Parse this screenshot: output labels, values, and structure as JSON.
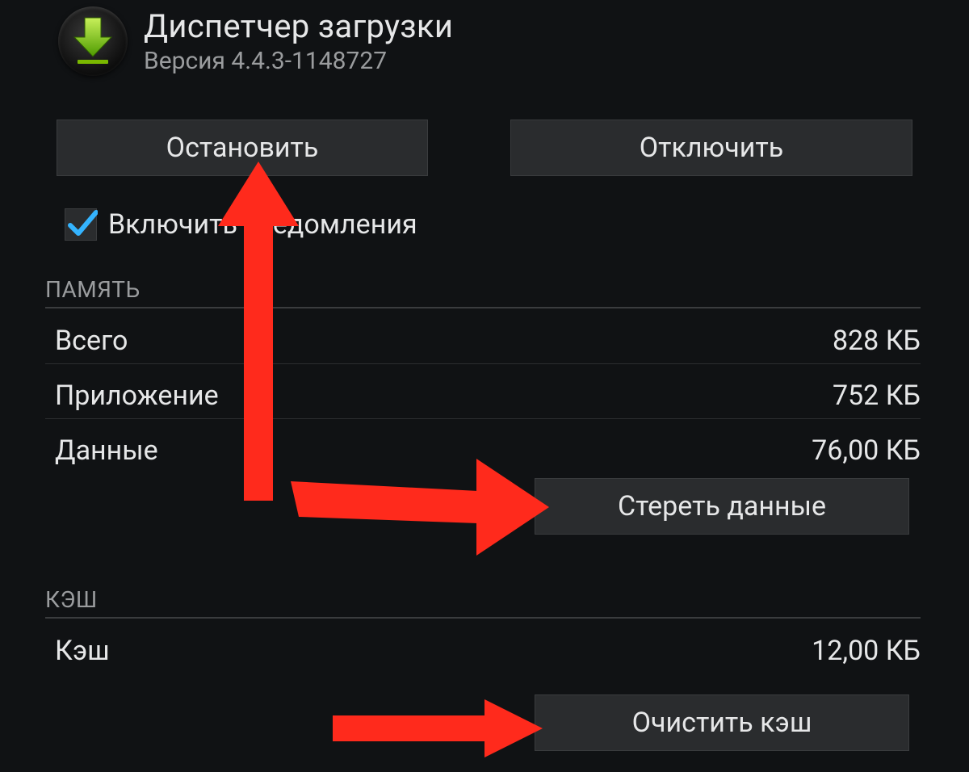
{
  "header": {
    "title": "Диспетчер загрузки",
    "version": "Версия 4.4.3-1148727"
  },
  "buttons": {
    "stop": "Остановить",
    "disable": "Отключить",
    "clear_data": "Стереть данные",
    "clear_cache": "Очистить кэш"
  },
  "checkbox": {
    "label": "Включить уведомления",
    "checked": true
  },
  "sections": {
    "memory_title": "ПАМЯТЬ",
    "cache_title": "КЭШ"
  },
  "memory": {
    "total_label": "Всего",
    "total_value": "828 КБ",
    "app_label": "Приложение",
    "app_value": "752 КБ",
    "data_label": "Данные",
    "data_value": "76,00 КБ"
  },
  "cache": {
    "label": "Кэш",
    "value": "12,00 КБ"
  }
}
